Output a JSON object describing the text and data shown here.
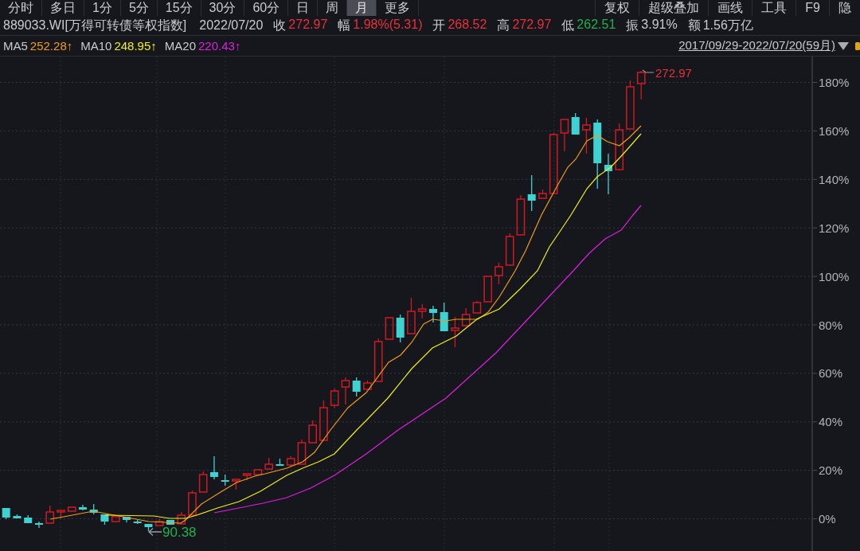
{
  "toolbar": {
    "period_tabs": [
      {
        "label": "分时",
        "selected": false
      },
      {
        "label": "多日",
        "selected": false
      },
      {
        "label": "1分",
        "selected": false
      },
      {
        "label": "5分",
        "selected": false
      },
      {
        "label": "15分",
        "selected": false
      },
      {
        "label": "30分",
        "selected": false
      },
      {
        "label": "60分",
        "selected": false
      },
      {
        "label": "日",
        "selected": false
      },
      {
        "label": "周",
        "selected": false
      },
      {
        "label": "月",
        "selected": true
      },
      {
        "label": "更多",
        "selected": false
      }
    ],
    "tools": [
      "复权",
      "超级叠加",
      "画线",
      "工具",
      "F9",
      "隐"
    ]
  },
  "quote": {
    "symbol": "889033.WI[万得可转债等权指数]",
    "date": "2022/07/20",
    "fields": [
      {
        "label": "收",
        "value": "272.97",
        "color": "#e8313b"
      },
      {
        "label": "幅",
        "value": "1.98%(5.31)",
        "color": "#e8313b"
      },
      {
        "label": "开",
        "value": "268.52",
        "color": "#e8313b"
      },
      {
        "label": "高",
        "value": "272.97",
        "color": "#e8313b"
      },
      {
        "label": "低",
        "value": "262.51",
        "color": "#22b04a"
      },
      {
        "label": "振",
        "value": "3.91%",
        "color": "#c9cacd"
      },
      {
        "label": "额",
        "value": "1.56万亿",
        "color": "#c9cacd"
      }
    ]
  },
  "indicators": {
    "moving_averages": [
      {
        "name": "MA5",
        "value": "252.28↑",
        "color": "#f29b1d"
      },
      {
        "name": "MA10",
        "value": "248.95↑",
        "color": "#eeee1c"
      },
      {
        "name": "MA20",
        "value": "220.43↑",
        "color": "#e01ee0"
      }
    ],
    "date_range": "2017/09/29-2022/07/20(59月)"
  },
  "chart": {
    "y_axis_labels": [
      "180%",
      "160%",
      "140%",
      "120%",
      "100%",
      "80%",
      "60%",
      "40%",
      "20%",
      "0%"
    ],
    "high_marker": "272.97",
    "low_marker": "90.38"
  }
}
